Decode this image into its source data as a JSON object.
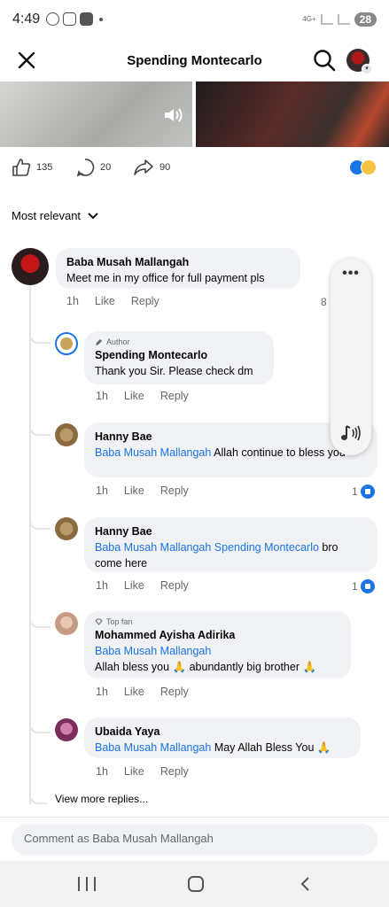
{
  "status_bar": {
    "time": "4:49",
    "network": "4G+",
    "battery": "28"
  },
  "header": {
    "title": "Spending Montecarlo"
  },
  "reactions": {
    "likes": "135",
    "comments": "20",
    "shares": "90"
  },
  "sort": {
    "label": "Most relevant"
  },
  "comments": [
    {
      "name": "Baba Musah Mallangah",
      "text": "Meet me in my office for full payment pls",
      "time": "1h",
      "like": "Like",
      "reply": "Reply",
      "count": "8"
    },
    {
      "badge": "Author",
      "name": "Spending Montecarlo",
      "text": "Thank you Sir. Please check dm",
      "time": "1h",
      "like": "Like",
      "reply": "Reply"
    },
    {
      "name": "Hanny Bae",
      "mention": "Baba Musah Mallangah",
      "text": " Allah continue to bless you",
      "time": "1h",
      "like": "Like",
      "reply": "Reply",
      "count": "1"
    },
    {
      "name": "Hanny Bae",
      "mention": "Baba Musah Mallangah Spending Montecarlo",
      "text": " bro come here",
      "time": "1h",
      "like": "Like",
      "reply": "Reply",
      "count": "1"
    },
    {
      "badge": "Top fan",
      "name": "Mohammed Ayisha Adirika",
      "mention": "Baba Musah Mallangah",
      "text": "Allah bless you 🙏 abundantly big brother 🙏",
      "time": "1h",
      "like": "Like",
      "reply": "Reply"
    },
    {
      "name": "Ubaida Yaya",
      "mention": "Baba Musah Mallangah",
      "text": " May Allah Bless You 🙏",
      "time": "1h",
      "like": "Like",
      "reply": "Reply"
    }
  ],
  "view_more": "View more replies...",
  "composer": {
    "placeholder": "Comment as Baba Musah Mallangah"
  }
}
